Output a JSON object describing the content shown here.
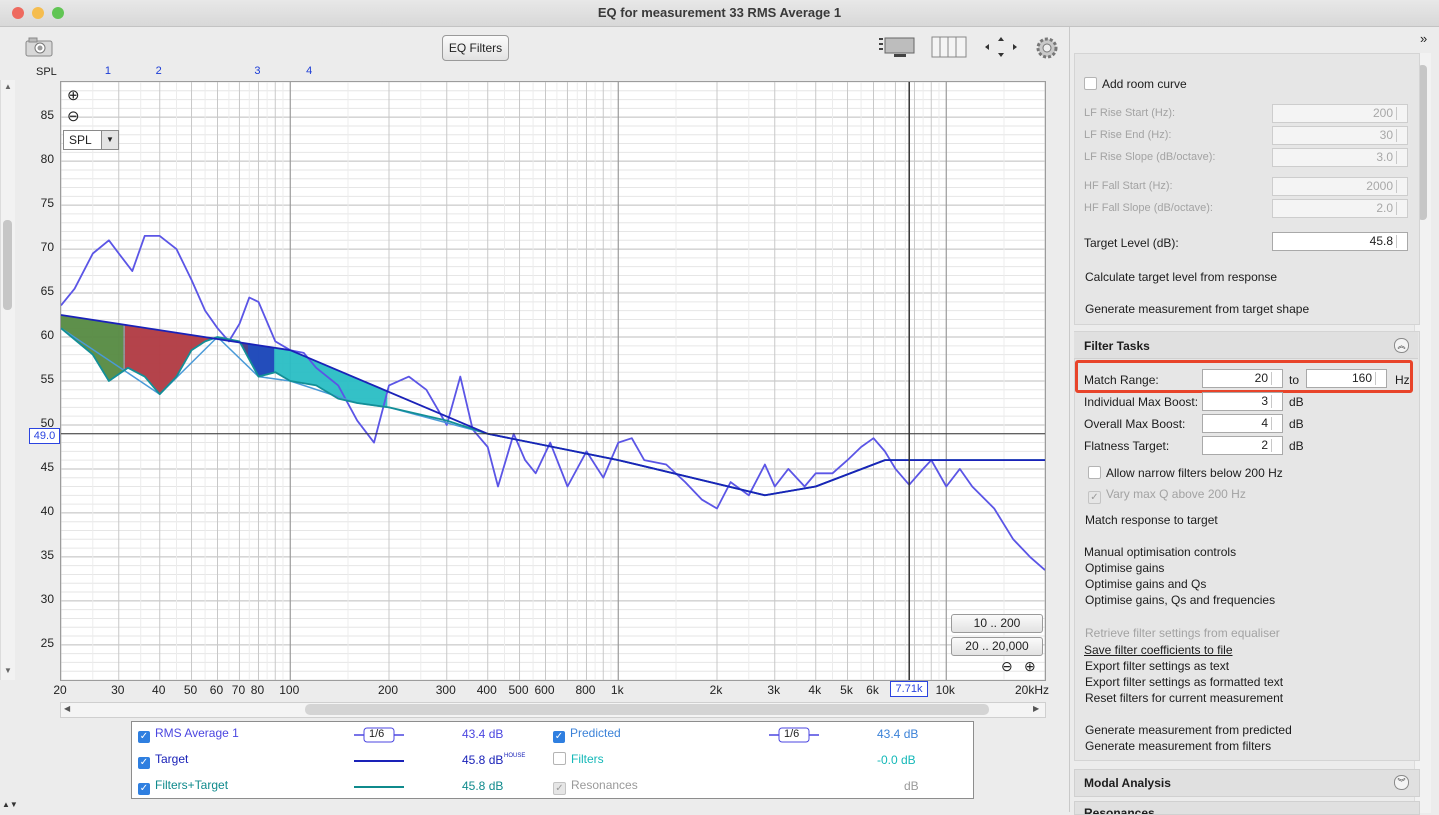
{
  "window": {
    "title": "EQ for measurement 33 RMS Average 1"
  },
  "toolbar": {
    "eq_filters": "EQ Filters"
  },
  "chart_data": {
    "type": "line",
    "ylabel": "SPL",
    "y_ticks": [
      "85",
      "80",
      "75",
      "70",
      "65",
      "60",
      "55",
      "50",
      "45",
      "40",
      "35",
      "30",
      "25"
    ],
    "x_ticks": [
      "20",
      "30",
      "40",
      "50",
      "60",
      "70",
      "80",
      "100",
      "200",
      "300",
      "400",
      "500",
      "600",
      "800",
      "1k",
      "2k",
      "3k",
      "4k",
      "5k",
      "6k",
      "7.71k",
      "10k",
      "20kHz"
    ],
    "filter_markers": [
      "1",
      "2",
      "3",
      "4"
    ],
    "cursor": {
      "y_label": "49.0",
      "x_label": "7.71k"
    },
    "xlim": [
      20,
      20000
    ],
    "ylim": [
      21,
      89
    ],
    "x_scale": "log",
    "series": [
      {
        "name": "RMS Average 1",
        "color": "#5b55e6",
        "x": [
          20,
          22,
          25,
          28,
          30,
          33,
          36,
          40,
          45,
          50,
          55,
          60,
          65,
          70,
          75,
          80,
          90,
          100,
          110,
          120,
          140,
          160,
          180,
          200,
          230,
          260,
          300,
          330,
          360,
          400,
          430,
          480,
          520,
          560,
          620,
          700,
          800,
          900,
          1000,
          1100,
          1200,
          1400,
          1600,
          1800,
          2000,
          2200,
          2500,
          2800,
          3000,
          3300,
          3700,
          4000,
          4500,
          5000,
          5500,
          6000,
          6500,
          7000,
          7710,
          8500,
          9000,
          10000,
          11000,
          12000,
          14000,
          16000,
          18000,
          20000
        ],
        "y": [
          63.6,
          65.5,
          69.5,
          71.0,
          69.5,
          67.5,
          71.5,
          71.5,
          70.0,
          66.5,
          63.0,
          61.0,
          59.5,
          61.5,
          64.5,
          64.0,
          59.5,
          58.5,
          58.2,
          56.5,
          54.5,
          50.5,
          48.0,
          54.5,
          55.5,
          54.0,
          50.0,
          55.5,
          49.5,
          47.5,
          43.0,
          49.0,
          46.0,
          44.5,
          48.0,
          43.0,
          47.0,
          44.0,
          48.0,
          48.5,
          46.0,
          45.5,
          43.5,
          41.5,
          40.5,
          43.5,
          42.0,
          45.5,
          43.0,
          45.0,
          43.0,
          44.5,
          44.5,
          46.0,
          47.5,
          48.5,
          47.0,
          45.0,
          43.2,
          45.0,
          46.0,
          43.0,
          45.0,
          43.0,
          40.5,
          37.0,
          35.0,
          33.5
        ]
      },
      {
        "name": "Target",
        "color": "#1a22b8",
        "x": [
          20,
          100,
          400,
          1000,
          2800,
          4000,
          6500,
          20000
        ],
        "y": [
          62.5,
          58.5,
          49.0,
          46.0,
          42.0,
          43.0,
          46.0,
          46.0
        ]
      },
      {
        "name": "Filters+Target",
        "color": "#128f97",
        "x": [
          20,
          25,
          28,
          32,
          36,
          40,
          45,
          50,
          55,
          60,
          70,
          80,
          90,
          100,
          120,
          140,
          160,
          200,
          300,
          400,
          1000,
          2800,
          4000,
          6500,
          20000
        ],
        "y": [
          61.0,
          58.0,
          55.0,
          56.5,
          55.5,
          53.5,
          55.5,
          58.5,
          59.5,
          60.0,
          59.5,
          55.5,
          56.0,
          55.0,
          54.5,
          53.0,
          52.5,
          52.0,
          50.5,
          49.0,
          46.0,
          42.0,
          43.0,
          46.0,
          46.0
        ]
      },
      {
        "name": "Predicted",
        "color": "#4a9ad8",
        "x": [
          20,
          40,
          60,
          80,
          100,
          160,
          200,
          400,
          1000,
          2800,
          4000,
          6500,
          20000
        ],
        "y": [
          61.0,
          53.5,
          60.0,
          55.5,
          55.0,
          52.5,
          52.0,
          49.0,
          46.0,
          42.0,
          43.0,
          46.0,
          46.0
        ]
      }
    ]
  },
  "zoom_buttons": {
    "range_1": "10 .. 200",
    "range_2": "20 .. 20,000"
  },
  "spl_select": "SPL",
  "legend": {
    "rows": [
      {
        "label": "RMS Average 1",
        "smoothing": "1/6",
        "value": "43.4 dB",
        "note": "",
        "color": "#4b46e0"
      },
      {
        "label": "Target",
        "smoothing": "",
        "value": "45.8 dB",
        "note": "HOUSE",
        "color": "#1a22b8"
      },
      {
        "label": "Filters+Target",
        "smoothing": "",
        "value": "45.8 dB",
        "note": "",
        "color": "#0f8a8c"
      }
    ],
    "rows_right": [
      {
        "label": "Predicted",
        "smoothing": "1/6",
        "value": "43.4 dB",
        "color": "#3b82d8"
      },
      {
        "label": "Filters",
        "smoothing": "",
        "value": "-0.0 dB",
        "color": "#14b8b8"
      },
      {
        "label": "Resonances",
        "smoothing": "",
        "value": "dB",
        "color": "#9a9a9a"
      }
    ]
  },
  "panel": {
    "add_room_curve": "Add room curve",
    "lf_rise_start": {
      "label": "LF Rise Start (Hz):",
      "value": "200"
    },
    "lf_rise_end": {
      "label": "LF Rise End (Hz):",
      "value": "30"
    },
    "lf_rise_slope": {
      "label": "LF Rise Slope (dB/octave):",
      "value": "3.0"
    },
    "hf_fall_start": {
      "label": "HF Fall Start (Hz):",
      "value": "2000"
    },
    "hf_fall_slope": {
      "label": "HF Fall Slope (dB/octave):",
      "value": "2.0"
    },
    "target_level": {
      "label": "Target Level (dB):",
      "value": "45.8"
    },
    "calc_target": "Calculate target level from response",
    "gen_from_target": "Generate measurement from target shape",
    "filter_tasks": "Filter Tasks",
    "match_range": {
      "label": "Match Range:",
      "from": "20",
      "to_word": "to",
      "to": "160",
      "unit": "Hz"
    },
    "indiv_max_boost": {
      "label": "Individual Max Boost:",
      "value": "3",
      "unit": "dB"
    },
    "overall_max_boost": {
      "label": "Overall Max Boost:",
      "value": "4",
      "unit": "dB"
    },
    "flatness_target": {
      "label": "Flatness Target:",
      "value": "2",
      "unit": "dB"
    },
    "allow_narrow": "Allow narrow filters below 200 Hz",
    "vary_max_q": "Vary max Q above 200 Hz",
    "match_response": "Match response to target",
    "manual_opt": "Manual optimisation controls",
    "opt_gains": "Optimise gains",
    "opt_gains_qs": "Optimise gains and Qs",
    "opt_gains_qs_freqs": "Optimise gains, Qs and frequencies",
    "retrieve": "Retrieve filter settings from equaliser",
    "save_coeff": "Save filter coefficients to file",
    "export_text": "Export filter settings as text",
    "export_formatted": "Export filter settings as formatted text",
    "reset_filters": "Reset filters for current measurement",
    "gen_predicted": "Generate measurement from predicted",
    "gen_filters": "Generate measurement from filters",
    "modal_analysis": "Modal Analysis",
    "resonances": "Resonances"
  },
  "colors": {
    "highlight": "#e8442a"
  }
}
